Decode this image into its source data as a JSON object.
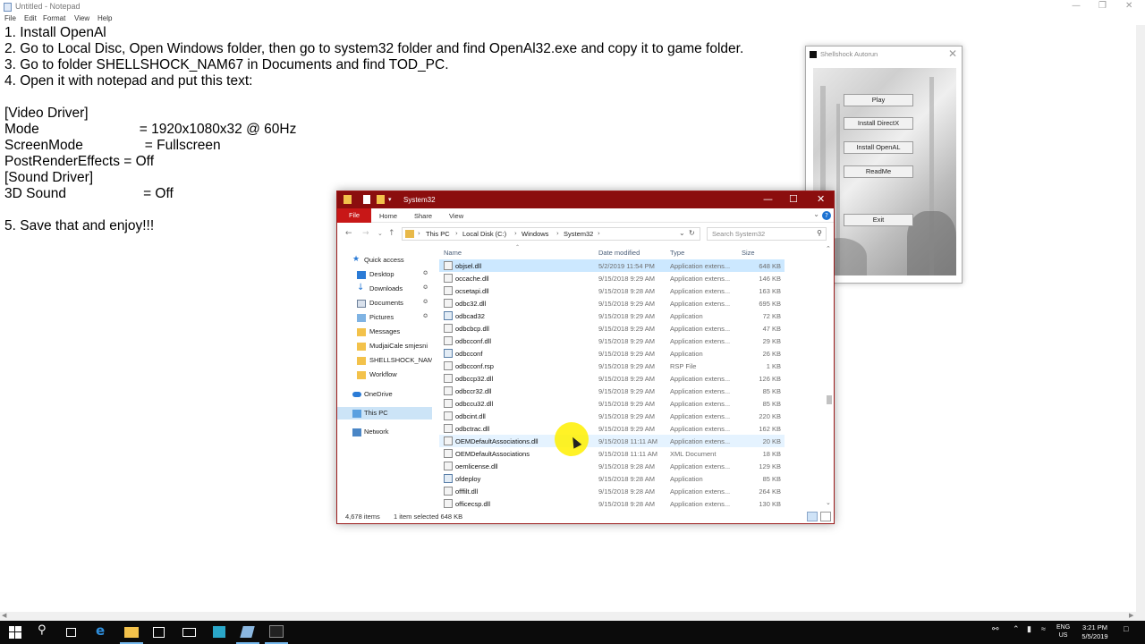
{
  "notepad": {
    "title": "Untitled - Notepad",
    "menu": [
      "File",
      "Edit",
      "Format",
      "View",
      "Help"
    ],
    "lines": [
      "1. Install OpenAl",
      "2. Go to Local Disc, Open Windows folder, then go to system32 folder and find OpenAl32.exe and copy it to game folder.",
      "3. Go to folder SHELLSHOCK_NAM67 in Documents and find TOD_PC.",
      "4. Open it with notepad and put this text:",
      "",
      "[Video Driver]",
      "Mode                          = 1920x1080x32 @ 60Hz",
      "ScreenMode                = Fullscreen",
      "PostRenderEffects = Off",
      "[Sound Driver]",
      "3D Sound                    = Off",
      "",
      "5. Save that and enjoy!!!"
    ]
  },
  "autorun": {
    "title": "Shellshock Autorun",
    "buttons": [
      "Play",
      "Install DirectX",
      "Install OpenAL",
      "ReadMe",
      "Exit"
    ]
  },
  "explorer": {
    "title": "System32",
    "ribbon_tabs": [
      "File",
      "Home",
      "Share",
      "View"
    ],
    "breadcrumb": [
      "This PC",
      "Local Disk (C:)",
      "Windows",
      "System32"
    ],
    "search_placeholder": "Search System32",
    "nav": {
      "quick_access": "Quick access",
      "items": [
        {
          "label": "Desktop",
          "icon": "desktop-icon",
          "pinned": true
        },
        {
          "label": "Downloads",
          "icon": "downloads-icon",
          "pinned": true
        },
        {
          "label": "Documents",
          "icon": "documents-icon",
          "pinned": true
        },
        {
          "label": "Pictures",
          "icon": "pictures-icon",
          "pinned": true
        },
        {
          "label": "Messages",
          "icon": "folder-icon",
          "pinned": false
        },
        {
          "label": "MudjaiCale smjesni",
          "icon": "folder-icon",
          "pinned": false
        },
        {
          "label": "SHELLSHOCK_NAM",
          "icon": "folder-icon",
          "pinned": false
        },
        {
          "label": "Workflow",
          "icon": "folder-icon",
          "pinned": false
        }
      ],
      "onedrive": "OneDrive",
      "this_pc": "This PC",
      "network": "Network"
    },
    "columns": [
      "Name",
      "Date modified",
      "Type",
      "Size"
    ],
    "files": [
      {
        "name": "objsel.dll",
        "date": "5/2/2019 11:54 PM",
        "type": "Application extens...",
        "size": "648 KB",
        "kind": "dll"
      },
      {
        "name": "occache.dll",
        "date": "9/15/2018 9:29 AM",
        "type": "Application extens...",
        "size": "146 KB",
        "kind": "dll"
      },
      {
        "name": "ocsetapi.dll",
        "date": "9/15/2018 9:28 AM",
        "type": "Application extens...",
        "size": "163 KB",
        "kind": "dll"
      },
      {
        "name": "odbc32.dll",
        "date": "9/15/2018 9:29 AM",
        "type": "Application extens...",
        "size": "695 KB",
        "kind": "dll"
      },
      {
        "name": "odbcad32",
        "date": "9/15/2018 9:29 AM",
        "type": "Application",
        "size": "72 KB",
        "kind": "app"
      },
      {
        "name": "odbcbcp.dll",
        "date": "9/15/2018 9:29 AM",
        "type": "Application extens...",
        "size": "47 KB",
        "kind": "dll"
      },
      {
        "name": "odbcconf.dll",
        "date": "9/15/2018 9:29 AM",
        "type": "Application extens...",
        "size": "29 KB",
        "kind": "dll"
      },
      {
        "name": "odbcconf",
        "date": "9/15/2018 9:29 AM",
        "type": "Application",
        "size": "26 KB",
        "kind": "app"
      },
      {
        "name": "odbcconf.rsp",
        "date": "9/15/2018 9:29 AM",
        "type": "RSP File",
        "size": "1 KB",
        "kind": "file"
      },
      {
        "name": "odbccp32.dll",
        "date": "9/15/2018 9:29 AM",
        "type": "Application extens...",
        "size": "126 KB",
        "kind": "dll"
      },
      {
        "name": "odbccr32.dll",
        "date": "9/15/2018 9:29 AM",
        "type": "Application extens...",
        "size": "85 KB",
        "kind": "dll"
      },
      {
        "name": "odbccu32.dll",
        "date": "9/15/2018 9:29 AM",
        "type": "Application extens...",
        "size": "85 KB",
        "kind": "dll"
      },
      {
        "name": "odbcint.dll",
        "date": "9/15/2018 9:29 AM",
        "type": "Application extens...",
        "size": "220 KB",
        "kind": "dll"
      },
      {
        "name": "odbctrac.dll",
        "date": "9/15/2018 9:29 AM",
        "type": "Application extens...",
        "size": "162 KB",
        "kind": "dll"
      },
      {
        "name": "OEMDefaultAssociations.dll",
        "date": "9/15/2018 11:11 AM",
        "type": "Application extens...",
        "size": "20 KB",
        "kind": "dll"
      },
      {
        "name": "OEMDefaultAssociations",
        "date": "9/15/2018 11:11 AM",
        "type": "XML Document",
        "size": "18 KB",
        "kind": "file"
      },
      {
        "name": "oemlicense.dll",
        "date": "9/15/2018 9:28 AM",
        "type": "Application extens...",
        "size": "129 KB",
        "kind": "dll"
      },
      {
        "name": "ofdeploy",
        "date": "9/15/2018 9:28 AM",
        "type": "Application",
        "size": "85 KB",
        "kind": "app"
      },
      {
        "name": "offfilt.dll",
        "date": "9/15/2018 9:28 AM",
        "type": "Application extens...",
        "size": "264 KB",
        "kind": "dll"
      },
      {
        "name": "officecsp.dll",
        "date": "9/15/2018 9:28 AM",
        "type": "Application extens...",
        "size": "130 KB",
        "kind": "dll"
      }
    ],
    "status_count": "4,678 items",
    "status_selected": "1 item selected  648 KB"
  },
  "taskbar": {
    "lang_top": "ENG",
    "lang_bottom": "US",
    "time": "3:21 PM",
    "date": "5/5/2019"
  },
  "colors": {
    "explorer_title": "#8b0e0e",
    "ribbon_file": "#c81717",
    "selection": "#cce8ff",
    "cursor_highlight": "#fff000"
  }
}
